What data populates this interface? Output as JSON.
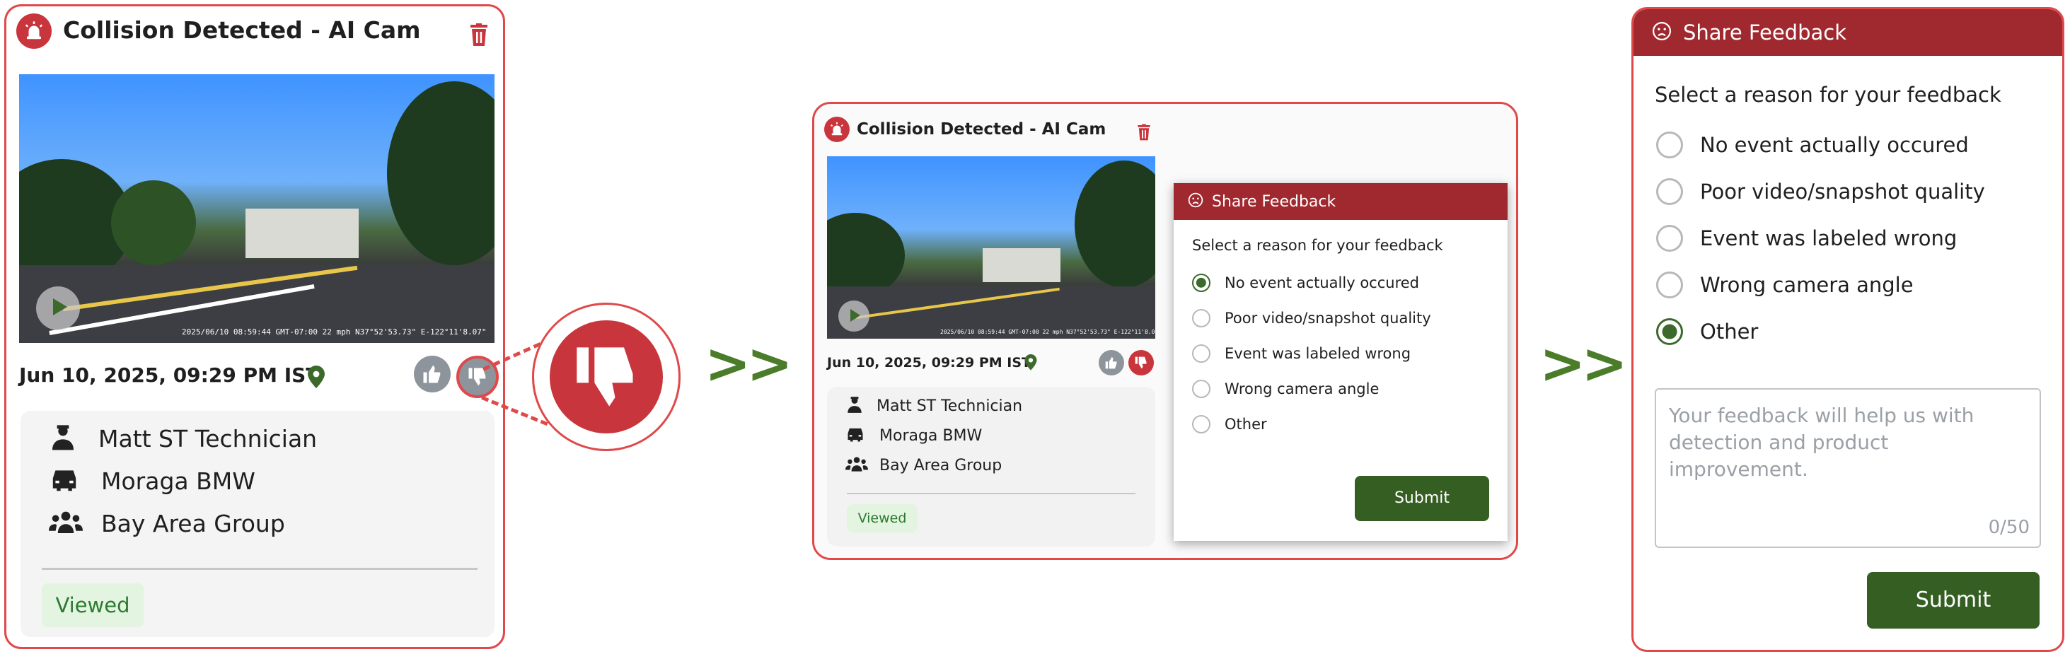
{
  "card": {
    "title": "Collision Detected - AI Cam",
    "video_stamp": "2025/06/10 08:59:44 GMT-07:00  22 mph  N37°52'53.73\" E-122°11'8.07\"",
    "date": "Jun 10, 2025, 09:29 PM IST",
    "driver": "Matt ST Technician",
    "vehicle": "Moraga BMW",
    "group": "Bay Area Group",
    "status": "Viewed"
  },
  "feedback": {
    "header": "Share Feedback",
    "prompt": "Select a reason for your feedback",
    "options": [
      "No event actually occured",
      "Poor video/snapshot quality",
      "Event was labeled wrong",
      "Wrong camera angle",
      "Other"
    ],
    "selected_panel2": "No event actually occured",
    "selected_panel3": "Other",
    "textarea_placeholder": "Your feedback will help us with detection and product improvement.",
    "counter": "0/50",
    "submit_label": "Submit"
  },
  "arrow_glyph": ">>",
  "colors": {
    "brand_red": "#c9353c",
    "header_red": "#a0282f",
    "submit_green": "#355e22",
    "viewed_bg": "#e3f4e1",
    "viewed_text": "#2c7a2f"
  },
  "icons": {
    "alarm": "siren-icon",
    "delete": "trash-icon",
    "play": "play-icon",
    "location": "map-pin-icon",
    "like": "thumbs-up-icon",
    "dislike": "thumbs-down-icon",
    "driver": "technician-icon",
    "vehicle": "car-icon",
    "group": "group-icon",
    "feedback": "sad-face-icon"
  }
}
